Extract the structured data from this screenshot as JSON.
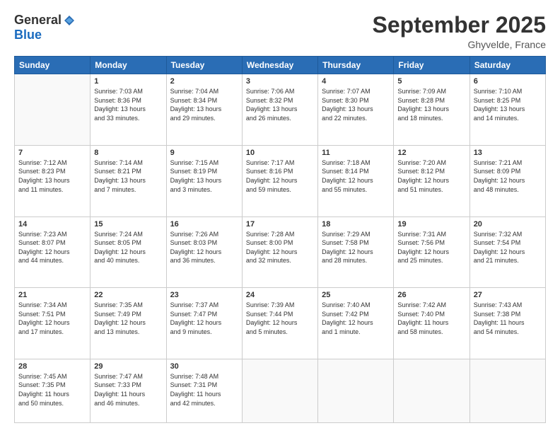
{
  "header": {
    "logo_general": "General",
    "logo_blue": "Blue",
    "month": "September 2025",
    "location": "Ghyvelde, France"
  },
  "days_of_week": [
    "Sunday",
    "Monday",
    "Tuesday",
    "Wednesday",
    "Thursday",
    "Friday",
    "Saturday"
  ],
  "weeks": [
    [
      {
        "day": "",
        "info": ""
      },
      {
        "day": "1",
        "info": "Sunrise: 7:03 AM\nSunset: 8:36 PM\nDaylight: 13 hours\nand 33 minutes."
      },
      {
        "day": "2",
        "info": "Sunrise: 7:04 AM\nSunset: 8:34 PM\nDaylight: 13 hours\nand 29 minutes."
      },
      {
        "day": "3",
        "info": "Sunrise: 7:06 AM\nSunset: 8:32 PM\nDaylight: 13 hours\nand 26 minutes."
      },
      {
        "day": "4",
        "info": "Sunrise: 7:07 AM\nSunset: 8:30 PM\nDaylight: 13 hours\nand 22 minutes."
      },
      {
        "day": "5",
        "info": "Sunrise: 7:09 AM\nSunset: 8:28 PM\nDaylight: 13 hours\nand 18 minutes."
      },
      {
        "day": "6",
        "info": "Sunrise: 7:10 AM\nSunset: 8:25 PM\nDaylight: 13 hours\nand 14 minutes."
      }
    ],
    [
      {
        "day": "7",
        "info": "Sunrise: 7:12 AM\nSunset: 8:23 PM\nDaylight: 13 hours\nand 11 minutes."
      },
      {
        "day": "8",
        "info": "Sunrise: 7:14 AM\nSunset: 8:21 PM\nDaylight: 13 hours\nand 7 minutes."
      },
      {
        "day": "9",
        "info": "Sunrise: 7:15 AM\nSunset: 8:19 PM\nDaylight: 13 hours\nand 3 minutes."
      },
      {
        "day": "10",
        "info": "Sunrise: 7:17 AM\nSunset: 8:16 PM\nDaylight: 12 hours\nand 59 minutes."
      },
      {
        "day": "11",
        "info": "Sunrise: 7:18 AM\nSunset: 8:14 PM\nDaylight: 12 hours\nand 55 minutes."
      },
      {
        "day": "12",
        "info": "Sunrise: 7:20 AM\nSunset: 8:12 PM\nDaylight: 12 hours\nand 51 minutes."
      },
      {
        "day": "13",
        "info": "Sunrise: 7:21 AM\nSunset: 8:09 PM\nDaylight: 12 hours\nand 48 minutes."
      }
    ],
    [
      {
        "day": "14",
        "info": "Sunrise: 7:23 AM\nSunset: 8:07 PM\nDaylight: 12 hours\nand 44 minutes."
      },
      {
        "day": "15",
        "info": "Sunrise: 7:24 AM\nSunset: 8:05 PM\nDaylight: 12 hours\nand 40 minutes."
      },
      {
        "day": "16",
        "info": "Sunrise: 7:26 AM\nSunset: 8:03 PM\nDaylight: 12 hours\nand 36 minutes."
      },
      {
        "day": "17",
        "info": "Sunrise: 7:28 AM\nSunset: 8:00 PM\nDaylight: 12 hours\nand 32 minutes."
      },
      {
        "day": "18",
        "info": "Sunrise: 7:29 AM\nSunset: 7:58 PM\nDaylight: 12 hours\nand 28 minutes."
      },
      {
        "day": "19",
        "info": "Sunrise: 7:31 AM\nSunset: 7:56 PM\nDaylight: 12 hours\nand 25 minutes."
      },
      {
        "day": "20",
        "info": "Sunrise: 7:32 AM\nSunset: 7:54 PM\nDaylight: 12 hours\nand 21 minutes."
      }
    ],
    [
      {
        "day": "21",
        "info": "Sunrise: 7:34 AM\nSunset: 7:51 PM\nDaylight: 12 hours\nand 17 minutes."
      },
      {
        "day": "22",
        "info": "Sunrise: 7:35 AM\nSunset: 7:49 PM\nDaylight: 12 hours\nand 13 minutes."
      },
      {
        "day": "23",
        "info": "Sunrise: 7:37 AM\nSunset: 7:47 PM\nDaylight: 12 hours\nand 9 minutes."
      },
      {
        "day": "24",
        "info": "Sunrise: 7:39 AM\nSunset: 7:44 PM\nDaylight: 12 hours\nand 5 minutes."
      },
      {
        "day": "25",
        "info": "Sunrise: 7:40 AM\nSunset: 7:42 PM\nDaylight: 12 hours\nand 1 minute."
      },
      {
        "day": "26",
        "info": "Sunrise: 7:42 AM\nSunset: 7:40 PM\nDaylight: 11 hours\nand 58 minutes."
      },
      {
        "day": "27",
        "info": "Sunrise: 7:43 AM\nSunset: 7:38 PM\nDaylight: 11 hours\nand 54 minutes."
      }
    ],
    [
      {
        "day": "28",
        "info": "Sunrise: 7:45 AM\nSunset: 7:35 PM\nDaylight: 11 hours\nand 50 minutes."
      },
      {
        "day": "29",
        "info": "Sunrise: 7:47 AM\nSunset: 7:33 PM\nDaylight: 11 hours\nand 46 minutes."
      },
      {
        "day": "30",
        "info": "Sunrise: 7:48 AM\nSunset: 7:31 PM\nDaylight: 11 hours\nand 42 minutes."
      },
      {
        "day": "",
        "info": ""
      },
      {
        "day": "",
        "info": ""
      },
      {
        "day": "",
        "info": ""
      },
      {
        "day": "",
        "info": ""
      }
    ]
  ]
}
